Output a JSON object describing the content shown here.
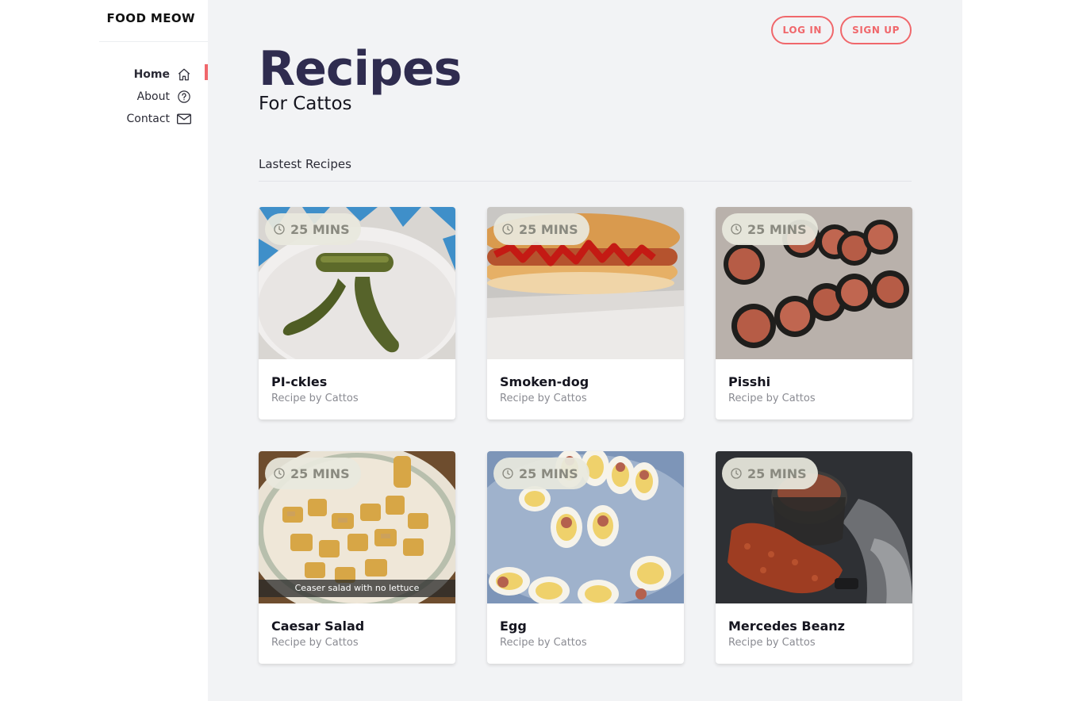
{
  "brand": "FOOD MEOW",
  "nav": [
    {
      "label": "Home",
      "icon": "home-icon",
      "active": true
    },
    {
      "label": "About",
      "icon": "question-icon",
      "active": false
    },
    {
      "label": "Contact",
      "icon": "mail-icon",
      "active": false
    }
  ],
  "auth": {
    "login": "LOG IN",
    "signup": "SIGN UP"
  },
  "hero": {
    "title": "Recipes",
    "subtitle": "For Cattos"
  },
  "section": {
    "heading": "Lastest Recipes"
  },
  "recipes": [
    {
      "name": "PI-ckles",
      "by": "Recipe by Cattos",
      "time": "25 MINS",
      "caption": ""
    },
    {
      "name": "Smoken-dog",
      "by": "Recipe by Cattos",
      "time": "25 MINS",
      "caption": ""
    },
    {
      "name": "Pisshi",
      "by": "Recipe by Cattos",
      "time": "25 MINS",
      "caption": ""
    },
    {
      "name": "Caesar Salad",
      "by": "Recipe by Cattos",
      "time": "25 MINS",
      "caption": "Ceaser salad with no lettuce"
    },
    {
      "name": "Egg",
      "by": "Recipe by Cattos",
      "time": "25 MINS",
      "caption": ""
    },
    {
      "name": "Mercedes Beanz",
      "by": "Recipe by Cattos",
      "time": "25 MINS",
      "caption": ""
    }
  ],
  "colors": {
    "accent": "#f0676b",
    "title": "#2f2c4f",
    "background": "#f2f3f5"
  }
}
